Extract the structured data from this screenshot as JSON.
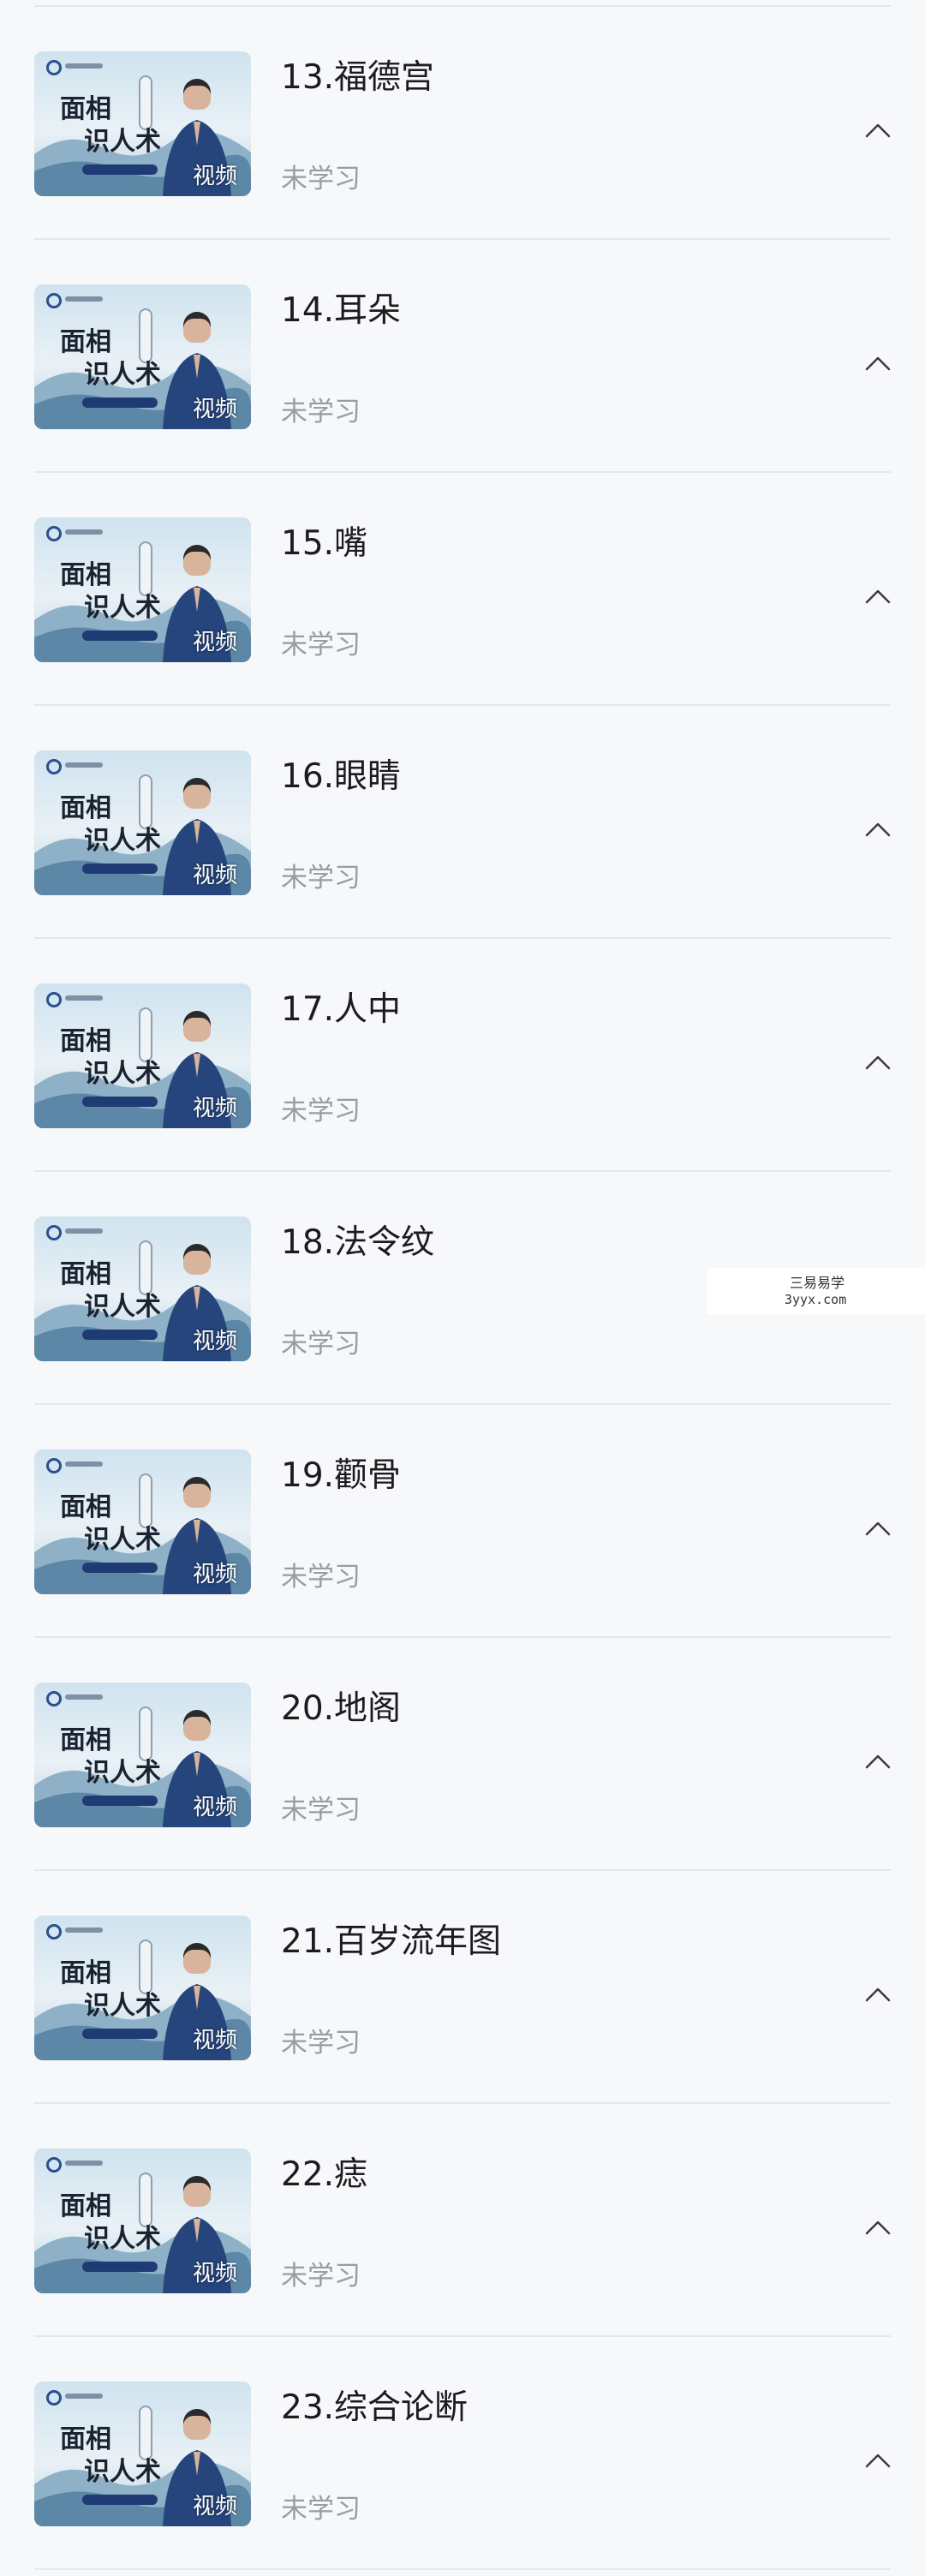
{
  "lessons": [
    {
      "number_title": "13.福德宫",
      "status": "未学习",
      "badge": "视频",
      "cover_title_1": "面相",
      "cover_title_2": "识人术",
      "show_chevron": true
    },
    {
      "number_title": "14.耳朵",
      "status": "未学习",
      "badge": "视频",
      "cover_title_1": "面相",
      "cover_title_2": "识人术",
      "show_chevron": true
    },
    {
      "number_title": "15.嘴",
      "status": "未学习",
      "badge": "视频",
      "cover_title_1": "面相",
      "cover_title_2": "识人术",
      "show_chevron": true
    },
    {
      "number_title": "16.眼睛",
      "status": "未学习",
      "badge": "视频",
      "cover_title_1": "面相",
      "cover_title_2": "识人术",
      "show_chevron": true
    },
    {
      "number_title": "17.人中",
      "status": "未学习",
      "badge": "视频",
      "cover_title_1": "面相",
      "cover_title_2": "识人术",
      "show_chevron": true
    },
    {
      "number_title": "18.法令纹",
      "status": "未学习",
      "badge": "视频",
      "cover_title_1": "面相",
      "cover_title_2": "识人术",
      "show_chevron": false
    },
    {
      "number_title": "19.颧骨",
      "status": "未学习",
      "badge": "视频",
      "cover_title_1": "面相",
      "cover_title_2": "识人术",
      "show_chevron": true
    },
    {
      "number_title": "20.地阁",
      "status": "未学习",
      "badge": "视频",
      "cover_title_1": "面相",
      "cover_title_2": "识人术",
      "show_chevron": true
    },
    {
      "number_title": "21.百岁流年图",
      "status": "未学习",
      "badge": "视频",
      "cover_title_1": "面相",
      "cover_title_2": "识人术",
      "show_chevron": true
    },
    {
      "number_title": "22.痣",
      "status": "未学习",
      "badge": "视频",
      "cover_title_1": "面相",
      "cover_title_2": "识人术",
      "show_chevron": true
    },
    {
      "number_title": "23.综合论断",
      "status": "未学习",
      "badge": "视频",
      "cover_title_1": "面相",
      "cover_title_2": "识人术",
      "show_chevron": true
    }
  ],
  "watermark": {
    "line1": "三易易学",
    "line2": "3yyx.com"
  },
  "colors": {
    "background": "#f7f8fa",
    "title": "#1c1c1e",
    "status": "#9a9ca3",
    "divider": "#e6e7ea"
  },
  "icons": {
    "chevron": "chevron-up-icon"
  }
}
